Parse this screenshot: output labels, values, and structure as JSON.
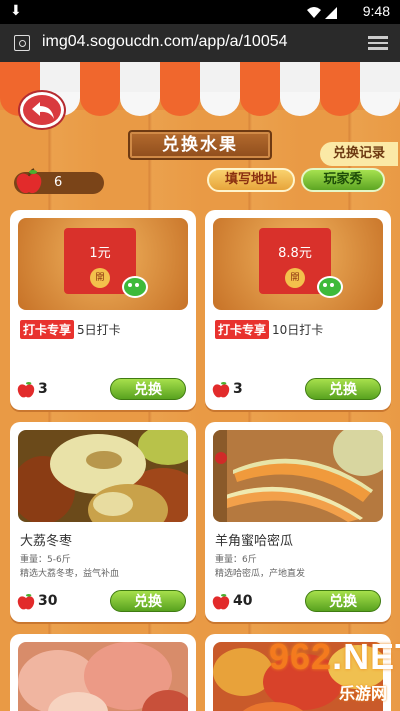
{
  "status_bar": {
    "time": "9:48"
  },
  "browser": {
    "url": "img04.sogoucdn.com/app/a/10054"
  },
  "page": {
    "title": "兑换水果",
    "record_label": "兑换记录",
    "apple_count": "6",
    "address_label": "填写地址",
    "show_label": "玩家秀"
  },
  "cards": [
    {
      "amount": "1元",
      "seal": "開",
      "tag": "打卡专享",
      "desc": "5日打卡",
      "price": "3",
      "button": "兑换"
    },
    {
      "amount": "8.8元",
      "seal": "開",
      "tag": "打卡专享",
      "desc": "10日打卡",
      "price": "3",
      "button": "兑换"
    },
    {
      "name": "大荔冬枣",
      "weight": "重量：5-6斤",
      "info": "精选大荔冬枣，益气补血",
      "price": "30",
      "button": "兑换"
    },
    {
      "name": "羊角蜜哈密瓜",
      "weight": "重量：6斤",
      "info": "精选哈密瓜，产地直发",
      "price": "40",
      "button": "兑换"
    }
  ],
  "watermark": {
    "big": "962",
    "big2": ".NET",
    "small": "乐游网"
  },
  "colors": {
    "accent_red": "#e8322e",
    "button_green": "#58a21f",
    "wood": "#e99a45"
  }
}
